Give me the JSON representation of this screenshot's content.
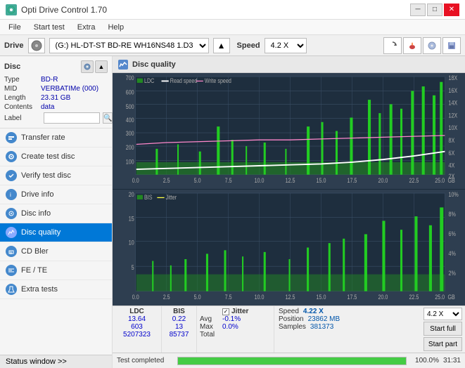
{
  "titlebar": {
    "title": "Opti Drive Control 1.70",
    "icon": "ODC",
    "minimize": "─",
    "maximize": "□",
    "close": "✕"
  },
  "menubar": {
    "items": [
      "File",
      "Start test",
      "Extra",
      "Help"
    ]
  },
  "drivebar": {
    "label": "Drive",
    "drive_value": "(G:) HL-DT-ST BD-RE  WH16NS48 1.D3",
    "speed_label": "Speed",
    "speed_value": "4.2 X"
  },
  "disc": {
    "title": "Disc",
    "type_label": "Type",
    "type_val": "BD-R",
    "mid_label": "MID",
    "mid_val": "VERBATIMe (000)",
    "length_label": "Length",
    "length_val": "23.31 GB",
    "contents_label": "Contents",
    "contents_val": "data",
    "label_label": "Label",
    "label_placeholder": ""
  },
  "nav": {
    "items": [
      {
        "id": "transfer-rate",
        "label": "Transfer rate",
        "icon_color": "blue"
      },
      {
        "id": "create-test-disc",
        "label": "Create test disc",
        "icon_color": "blue"
      },
      {
        "id": "verify-test-disc",
        "label": "Verify test disc",
        "icon_color": "blue"
      },
      {
        "id": "drive-info",
        "label": "Drive info",
        "icon_color": "blue"
      },
      {
        "id": "disc-info",
        "label": "Disc info",
        "icon_color": "blue"
      },
      {
        "id": "disc-quality",
        "label": "Disc quality",
        "icon_color": "blue",
        "active": true
      },
      {
        "id": "cd-bler",
        "label": "CD Bler",
        "icon_color": "blue"
      },
      {
        "id": "fe-te",
        "label": "FE / TE",
        "icon_color": "blue"
      },
      {
        "id": "extra-tests",
        "label": "Extra tests",
        "icon_color": "blue"
      }
    ]
  },
  "status_window": "Status window >>",
  "panel": {
    "title": "Disc quality"
  },
  "chart1": {
    "legend": {
      "ldc": "LDC",
      "read_speed": "Read speed",
      "write_speed": "Write speed"
    },
    "y_max": 700,
    "y_right_max": 18,
    "x_max": 25,
    "y_labels": [
      "700",
      "600",
      "500",
      "400",
      "300",
      "200",
      "100"
    ],
    "y_right_labels": [
      "18X",
      "16X",
      "14X",
      "12X",
      "10X",
      "8X",
      "6X",
      "4X",
      "2X"
    ],
    "x_labels": [
      "0.0",
      "2.5",
      "5.0",
      "7.5",
      "10.0",
      "12.5",
      "15.0",
      "17.5",
      "20.0",
      "22.5",
      "25.0"
    ],
    "x_unit": "GB"
  },
  "chart2": {
    "legend": {
      "bis": "BIS",
      "jitter": "Jitter"
    },
    "y_max": 20,
    "y_right_max": 10,
    "x_max": 25,
    "y_labels": [
      "20",
      "15",
      "10",
      "5"
    ],
    "y_right_labels": [
      "10%",
      "8%",
      "6%",
      "4%",
      "2%"
    ],
    "x_labels": [
      "0.0",
      "2.5",
      "5.0",
      "7.5",
      "10.0",
      "12.5",
      "15.0",
      "17.5",
      "20.0",
      "22.5",
      "25.0"
    ],
    "x_unit": "GB"
  },
  "stats": {
    "headers": {
      "ldc": "LDC",
      "bis": "BIS",
      "jitter": "Jitter",
      "speed_label": "Speed",
      "speed_val": "4.22 X",
      "position_label": "Position",
      "position_val": "23862 MB",
      "samples_label": "Samples",
      "samples_val": "381373"
    },
    "avg_label": "Avg",
    "avg_ldc": "13.64",
    "avg_bis": "0.22",
    "avg_jitter": "-0.1%",
    "max_label": "Max",
    "max_ldc": "603",
    "max_bis": "13",
    "max_jitter": "0.0%",
    "total_label": "Total",
    "total_ldc": "5207323",
    "total_bis": "85737",
    "jitter_check": "✓",
    "speed_dropdown": "4.2 X",
    "start_full": "Start full",
    "start_part": "Start part"
  },
  "progress": {
    "label": "Test completed",
    "pct": "100.0%",
    "time": "31:31"
  }
}
